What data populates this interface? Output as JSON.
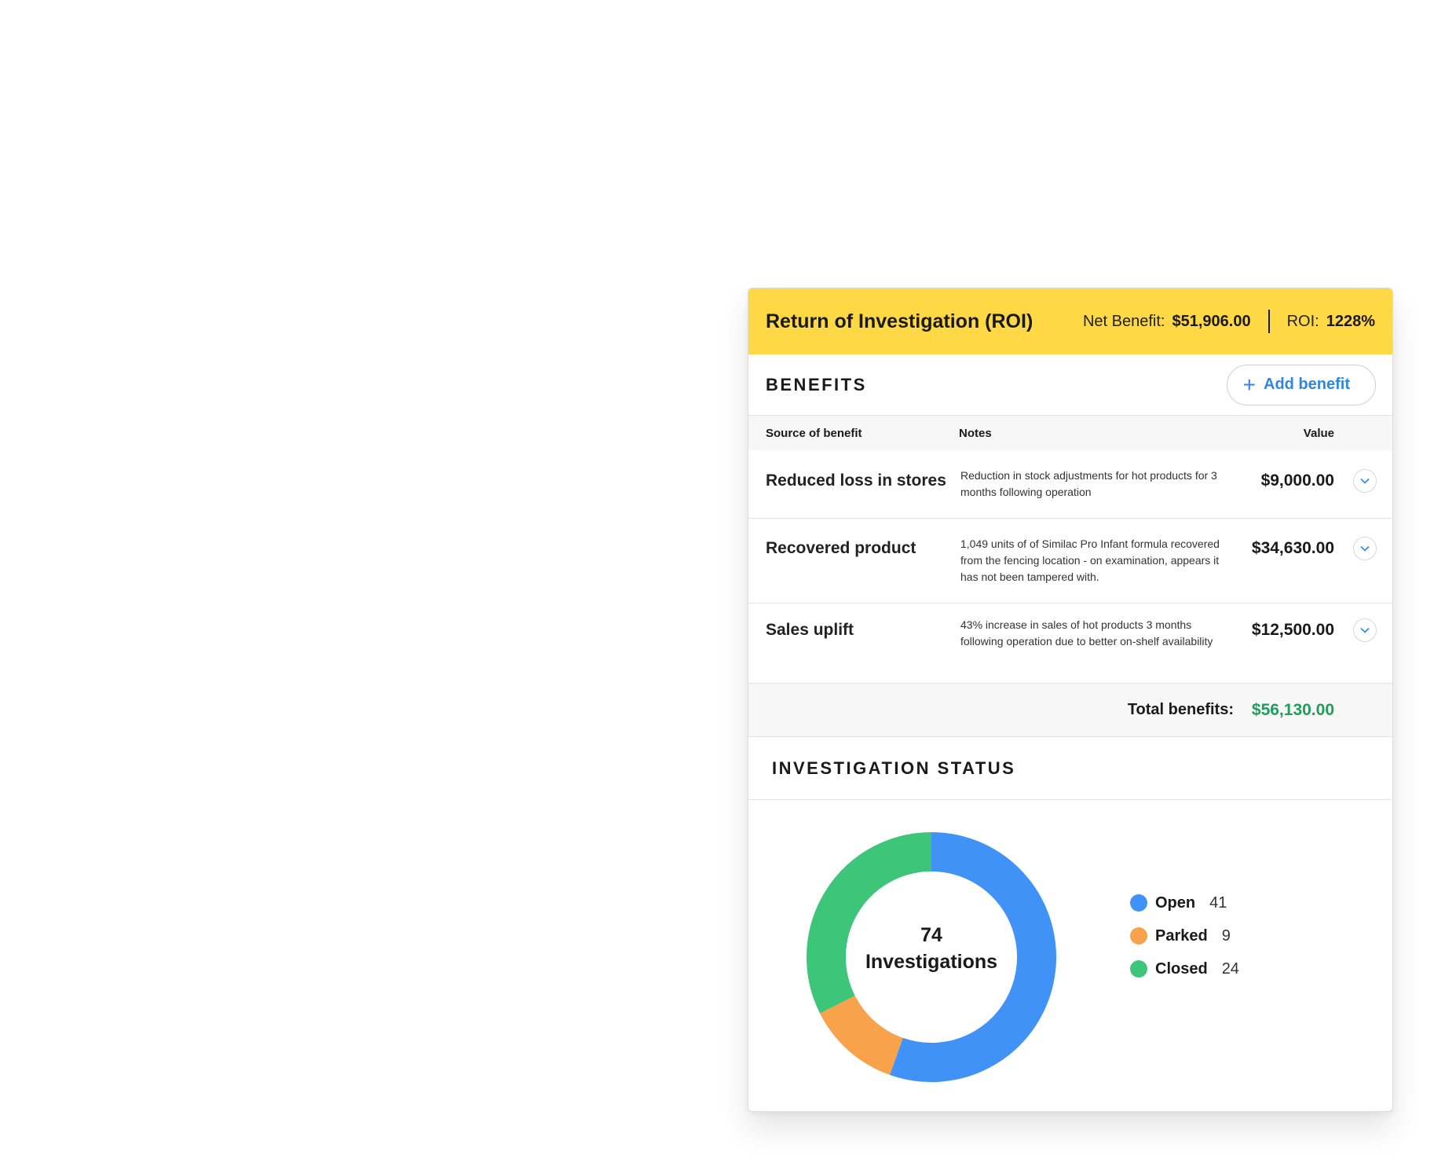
{
  "roi": {
    "title": "Return of Investigation (ROI)",
    "net_benefit_label": "Net Benefit:",
    "net_benefit_value": "$51,906.00",
    "roi_label": "ROI:",
    "roi_value": "1228%"
  },
  "benefits": {
    "title": "BENEFITS",
    "add_button": {
      "icon": "plus-icon",
      "label": "Add benefit"
    },
    "columns": {
      "source": "Source of benefit",
      "notes": "Notes",
      "value": "Value"
    },
    "rows": [
      {
        "source": "Reduced loss in stores",
        "notes": "Reduction in stock adjustments for hot products for 3 months following operation",
        "value": "$9,000.00"
      },
      {
        "source": "Recovered product",
        "notes": "1,049 units of of Similac Pro Infant formula recovered from the fencing location - on examination, appears it has not been tampered with.",
        "value": "$34,630.00"
      },
      {
        "source": "Sales uplift",
        "notes": "43% increase in sales of hot products 3 months following operation due to better on-shelf availability",
        "value": "$12,500.00"
      }
    ],
    "total_label": "Total benefits:",
    "total_value": "$56,130.00"
  },
  "status": {
    "title": "INVESTIGATION STATUS",
    "center_count": "74",
    "center_label": "Investigations"
  },
  "colors": {
    "header_bg": "#ffd945",
    "accent_blue": "#2f86e6",
    "total_green": "#1e9e5a",
    "open": "#4192f7",
    "parked": "#f8a24b",
    "closed": "#3dc57a"
  },
  "chart_data": {
    "type": "pie",
    "categories": [
      "Open",
      "Parked",
      "Closed"
    ],
    "values": [
      41,
      9,
      24
    ],
    "colors": [
      "#4192f7",
      "#f8a24b",
      "#3dc57a"
    ],
    "labels": [
      "41",
      "9",
      "24"
    ]
  }
}
